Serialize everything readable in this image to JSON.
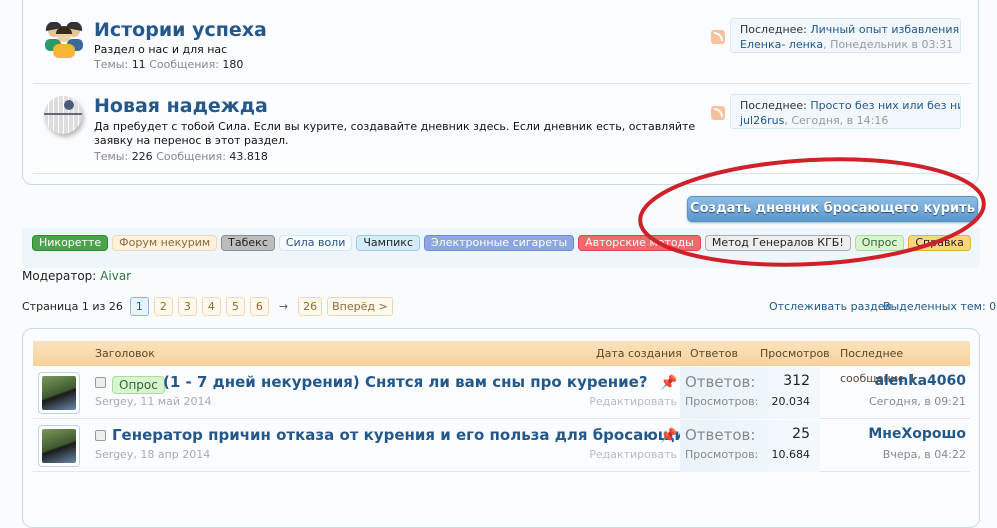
{
  "forums": [
    {
      "title": "Истории успеха",
      "description": "Раздел о нас и для нас",
      "themes_label": "Темы:",
      "themes": "11",
      "messages_label": "Сообщения:",
      "messages": "180",
      "icon": "people-icon",
      "last": {
        "label": "Последнее:",
        "title": "Личный опыт избавления о...",
        "user": "Еленка- ленка",
        "time": "Понедельник в 03:31"
      }
    },
    {
      "title": "Новая надежда",
      "description": "Да пребудет с тобой Сила. Если вы курите, создавайте дневник здесь. Если дневник есть, оставляйте заявку на перенос в этот раздел.",
      "themes_label": "Темы:",
      "themes": "226",
      "messages_label": "Сообщения:",
      "messages": "43.818",
      "icon": "death-star-icon",
      "last": {
        "label": "Последнее:",
        "title": "Просто без них или без них...",
        "user": "jul26rus",
        "time": "Сегодня, в 14:16"
      }
    }
  ],
  "create_button": "Создать дневник бросающего курить",
  "prefixes": [
    {
      "label": "Никоретте",
      "bg": "#4aa54a",
      "fg": "#ffffff",
      "border": "#2e8a2e"
    },
    {
      "label": "Форум некурим",
      "bg": "#fdf0dc",
      "fg": "#8a6b3a",
      "border": "#f0d9b5"
    },
    {
      "label": "Табекс",
      "bg": "#bdbdbd",
      "fg": "#222222",
      "border": "#8e8e8e"
    },
    {
      "label": "Сила воли",
      "bg": "#f7fbff",
      "fg": "#24588a",
      "border": "#d7e5f1"
    },
    {
      "label": "Чампикс",
      "bg": "#d4ecf7",
      "fg": "#222222",
      "border": "#9ccbe0"
    },
    {
      "label": "Электронные сигареты",
      "bg": "#8ba6e0",
      "fg": "#ffffff",
      "border": "#6f8ccc"
    },
    {
      "label": "Авторские методы",
      "bg": "#ee6a6a",
      "fg": "#ffffff",
      "border": "#d44c4c"
    },
    {
      "label": "Метод Генералов КГБ!",
      "bg": "#eeeeee",
      "fg": "#222222",
      "border": "#aaaaaa"
    },
    {
      "label": "Опрос",
      "bg": "#d8f5d0",
      "fg": "#2e6a2e",
      "border": "#a8dc9c"
    },
    {
      "label": "Справка",
      "bg": "#fdd57a",
      "fg": "#222222",
      "border": "#e6b040"
    }
  ],
  "moderator": {
    "label": "Модератор:",
    "name": "Aivar"
  },
  "pagination": {
    "label": "Страница 1 из 26",
    "pages": [
      "1",
      "2",
      "3",
      "4",
      "5",
      "6"
    ],
    "arrow": "→",
    "last": "26",
    "next": "Вперёд >"
  },
  "watch_link": "Отслеживать раздел",
  "selected": "Выделенных тем: 0",
  "table": {
    "headers": {
      "title": "Заголовок",
      "date": "Дата создания",
      "replies": "Ответов",
      "views": "Просмотров",
      "last": "Последнее сообщение ↓"
    },
    "rows": [
      {
        "prefix": "Опрос",
        "title": "(1 - 7 дней некурения) Снятся ли вам сны про курение?",
        "author": "Sergey",
        "date": "11 май 2014",
        "edit": "Редактировать",
        "replies_label": "Ответов:",
        "replies": "312",
        "views_label": "Просмотров:",
        "views": "20.034",
        "last_user": "alenka4060",
        "last_time": "Сегодня, в 09:21"
      },
      {
        "prefix": "",
        "title": "Генератор причин отказа от курения и его польза для бросающих курить",
        "author": "Sergey",
        "date": "18 апр 2014",
        "edit": "Редактировать",
        "replies_label": "Ответов:",
        "replies": "25",
        "views_label": "Просмотров:",
        "views": "10.684",
        "last_user": "МнеХорошо",
        "last_time": "Вчера, в 04:22"
      }
    ]
  },
  "colors": {
    "link": "#24588a",
    "annotation": "#d0202a",
    "header": "#f7d29c"
  }
}
